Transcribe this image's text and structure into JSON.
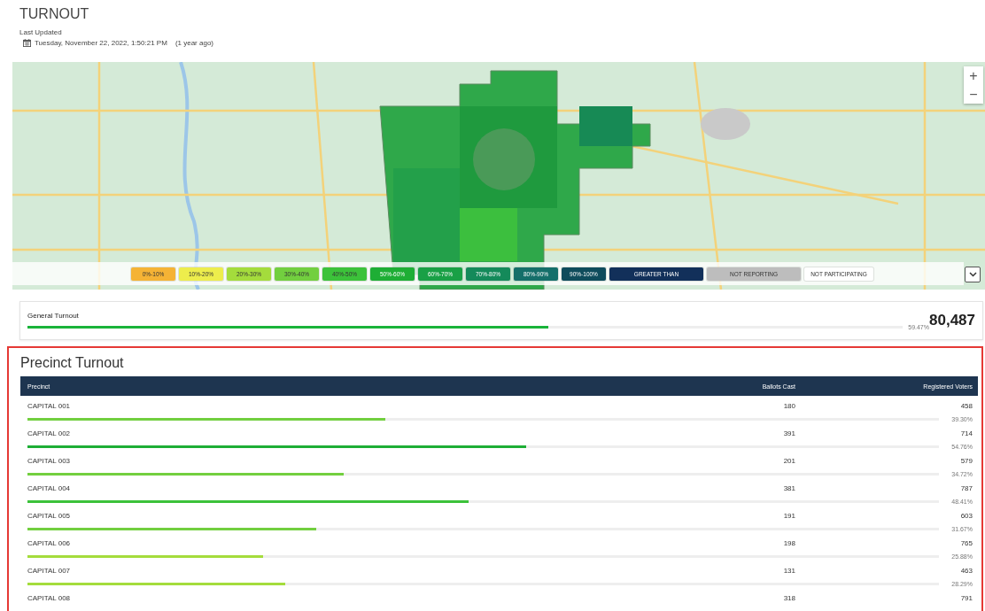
{
  "header": {
    "title": "TURNOUT",
    "updated_label": "Last Updated",
    "updated_value": "Tuesday, November 22, 2022, 1:50:21 PM",
    "updated_ago": "(1 year ago)"
  },
  "map": {
    "kind": "picture",
    "zoom_in": "+",
    "zoom_out": "−",
    "legend": [
      {
        "label": "0%-10%",
        "color": "#f5b335"
      },
      {
        "label": "10%-20%",
        "color": "#eded4c"
      },
      {
        "label": "20%-30%",
        "color": "#a4dc3c"
      },
      {
        "label": "30%-40%",
        "color": "#72cf3f"
      },
      {
        "label": "40%-50%",
        "color": "#3cc23a"
      },
      {
        "label": "50%-60%",
        "color": "#1eae35"
      },
      {
        "label": "60%-70%",
        "color": "#19a046"
      },
      {
        "label": "70%-80%",
        "color": "#148a5a"
      },
      {
        "label": "80%-90%",
        "color": "#156f6a"
      },
      {
        "label": "90%-100%",
        "color": "#0f4c5c"
      },
      {
        "label": "GREATER THAN",
        "color": "#12305a"
      },
      {
        "label": "NOT REPORTING",
        "color": "#bdbdbd"
      },
      {
        "label": "NOT PARTICIPATING",
        "color": "#ffffff"
      }
    ]
  },
  "general_turnout": {
    "label": "General Turnout",
    "level": 0.5947,
    "percent": "59.47%",
    "total": "80,487"
  },
  "precinct_turnout": {
    "title": "Precinct Turnout",
    "columns": [
      "Precinct",
      "Ballots Cast",
      "Registered Voters"
    ],
    "rows": [
      {
        "precinct": "CAPITAL 001",
        "ballots": "180",
        "registered": "458",
        "percent": "39.30%",
        "level": 0.393
      },
      {
        "precinct": "CAPITAL 002",
        "ballots": "391",
        "registered": "714",
        "percent": "54.76%",
        "level": 0.5476
      },
      {
        "precinct": "CAPITAL 003",
        "ballots": "201",
        "registered": "579",
        "percent": "34.72%",
        "level": 0.3472
      },
      {
        "precinct": "CAPITAL 004",
        "ballots": "381",
        "registered": "787",
        "percent": "48.41%",
        "level": 0.4841
      },
      {
        "precinct": "CAPITAL 005",
        "ballots": "191",
        "registered": "603",
        "percent": "31.67%",
        "level": 0.3167
      },
      {
        "precinct": "CAPITAL 006",
        "ballots": "198",
        "registered": "765",
        "percent": "25.88%",
        "level": 0.2588
      },
      {
        "precinct": "CAPITAL 007",
        "ballots": "131",
        "registered": "463",
        "percent": "28.29%",
        "level": 0.2829
      },
      {
        "precinct": "CAPITAL 008",
        "ballots": "318",
        "registered": "791"
      }
    ]
  }
}
